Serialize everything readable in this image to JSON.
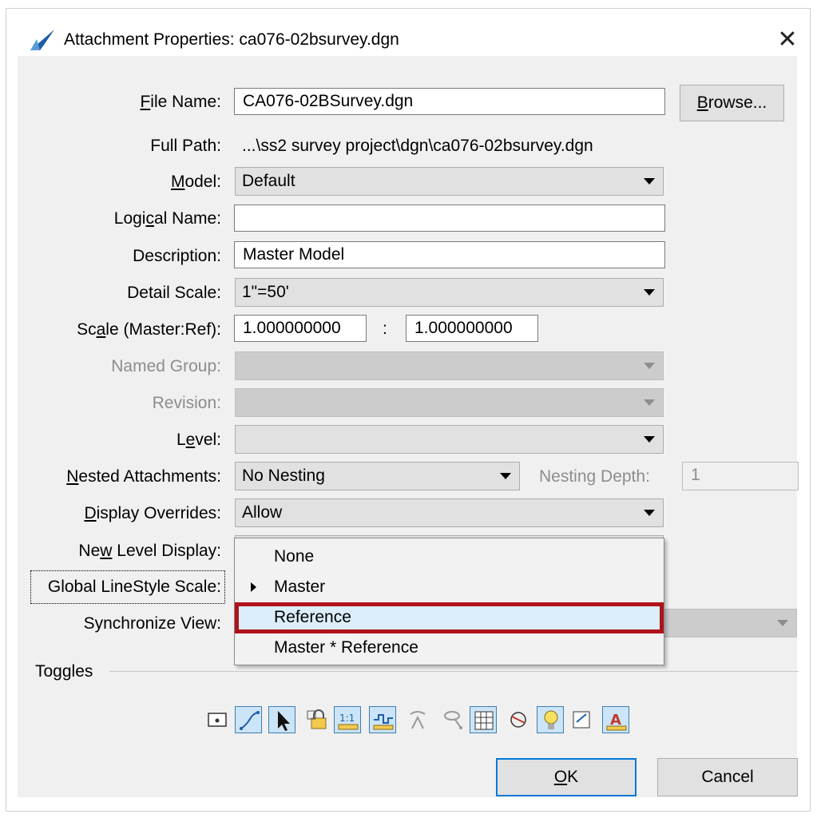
{
  "window": {
    "title": "Attachment Properties: ca076-02bsurvey.dgn",
    "close_symbol": "✕"
  },
  "form": {
    "file_name_label": "File Name:",
    "file_name_value": "CA076-02BSurvey.dgn",
    "browse_label": "Browse...",
    "full_path_label": "Full Path:",
    "full_path_value": "...\\ss2 survey project\\dgn\\ca076-02bsurvey.dgn",
    "model_label": "Model:",
    "model_value": "Default",
    "logical_name_label": "Logical Name:",
    "logical_name_value": "",
    "description_label": "Description:",
    "description_value": "Master Model",
    "detail_scale_label": "Detail Scale:",
    "detail_scale_value": "1\"=50'",
    "scale_label": "Scale (Master:Ref):",
    "scale_master": "1.000000000",
    "scale_sep": ":",
    "scale_ref": "1.000000000",
    "named_group_label": "Named Group:",
    "revision_label": "Revision:",
    "level_label": "Level:",
    "level_value": "",
    "nested_label": "Nested Attachments:",
    "nested_value": "No Nesting",
    "nesting_depth_label": "Nesting Depth:",
    "nesting_depth_value": "1",
    "display_overrides_label": "Display Overrides:",
    "display_overrides_value": "Allow",
    "new_level_display_label": "New Level Display:",
    "global_linestyle_label": "Global LineStyle Scale:",
    "synchronize_view_label": "Synchronize View:"
  },
  "dropdown": {
    "items": [
      "None",
      "Master",
      "Reference",
      "Master * Reference"
    ],
    "selected_index": 2,
    "current_index": 1
  },
  "toggles": {
    "label": "Toggles",
    "icons": [
      {
        "name": "display-toggle-icon",
        "on": false
      },
      {
        "name": "snap-toggle-icon",
        "on": true
      },
      {
        "name": "locate-toggle-icon",
        "on": true
      },
      {
        "name": "lock-toggle-icon",
        "on": false
      },
      {
        "name": "true-scale-toggle-icon",
        "on": true
      },
      {
        "name": "scale-line-styles-toggle-icon",
        "on": true
      },
      {
        "name": "treat-as-element-toggle-icon",
        "on": false
      },
      {
        "name": "ignore-attachment-toggle-icon",
        "on": false
      },
      {
        "name": "display-raster-toggle-icon",
        "on": true
      },
      {
        "name": "use-lights-toggle-icon",
        "on": false
      },
      {
        "name": "light-bulb-toggle-icon",
        "on": true
      },
      {
        "name": "annotation-toggle-icon",
        "on": false
      },
      {
        "name": "text-annotation-toggle-icon",
        "on": true
      }
    ]
  },
  "buttons": {
    "ok_label": "OK",
    "cancel_label": "Cancel"
  }
}
